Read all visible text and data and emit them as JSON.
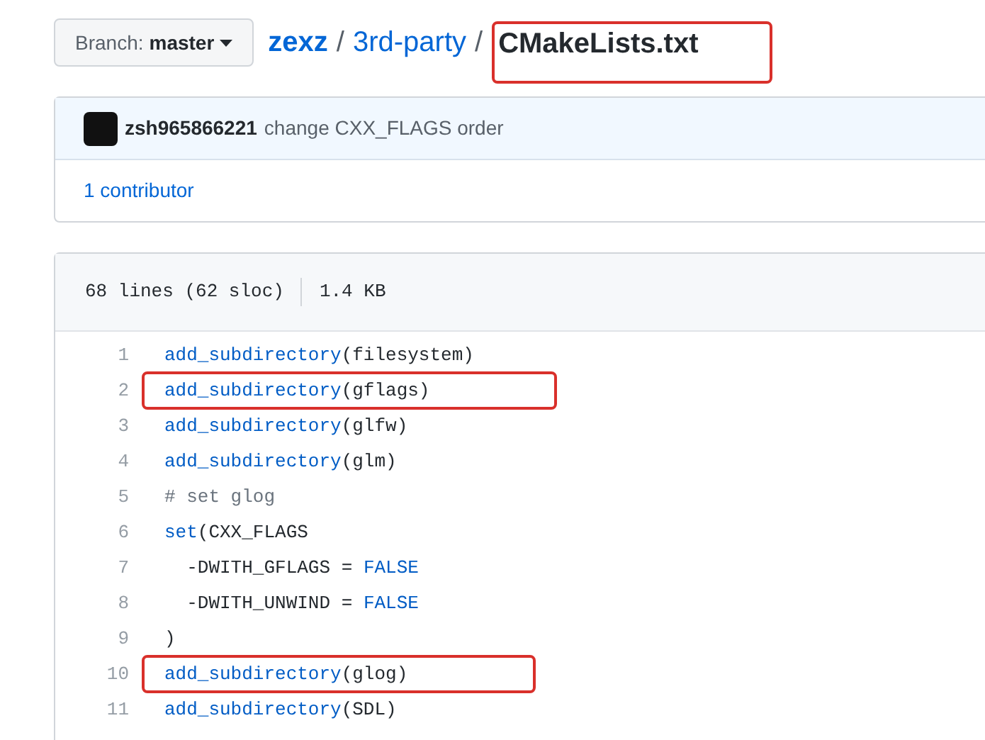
{
  "branch_button": {
    "label": "Branch:",
    "value": "master"
  },
  "breadcrumb": [
    {
      "text": "zexz",
      "kind": "repo",
      "annotated": false
    },
    {
      "text": "/",
      "kind": "separator",
      "annotated": false
    },
    {
      "text": "3rd-party",
      "kind": "folder",
      "annotated": false
    },
    {
      "text": "/",
      "kind": "separator",
      "annotated": false
    },
    {
      "text": "CMakeLists.txt",
      "kind": "file",
      "annotated": true
    }
  ],
  "commit": {
    "author": "zsh965866221",
    "message": "change CXX_FLAGS order",
    "contributors": "1 contributor"
  },
  "file_info": {
    "lines": "68 lines (62 sloc)",
    "size": "1.4 KB"
  },
  "code_lines": [
    {
      "number": "1",
      "annotated": false,
      "tokens": [
        {
          "kind": "fn",
          "text": "add_subdirectory"
        },
        {
          "kind": "plain",
          "text": "(filesystem)"
        }
      ]
    },
    {
      "number": "2",
      "annotated": true,
      "tokens": [
        {
          "kind": "fn",
          "text": "add_subdirectory"
        },
        {
          "kind": "plain",
          "text": "(gflags)"
        }
      ]
    },
    {
      "number": "3",
      "annotated": false,
      "tokens": [
        {
          "kind": "fn",
          "text": "add_subdirectory"
        },
        {
          "kind": "plain",
          "text": "(glfw)"
        }
      ]
    },
    {
      "number": "4",
      "annotated": false,
      "tokens": [
        {
          "kind": "fn",
          "text": "add_subdirectory"
        },
        {
          "kind": "plain",
          "text": "(glm)"
        }
      ]
    },
    {
      "number": "5",
      "annotated": false,
      "tokens": [
        {
          "kind": "comment",
          "text": "# set glog"
        }
      ]
    },
    {
      "number": "6",
      "annotated": false,
      "tokens": [
        {
          "kind": "fn",
          "text": "set"
        },
        {
          "kind": "plain",
          "text": "(CXX_FLAGS"
        }
      ]
    },
    {
      "number": "7",
      "annotated": false,
      "tokens": [
        {
          "kind": "plain",
          "text": "  -DWITH_GFLAGS = "
        },
        {
          "kind": "const",
          "text": "FALSE"
        }
      ]
    },
    {
      "number": "8",
      "annotated": false,
      "tokens": [
        {
          "kind": "plain",
          "text": "  -DWITH_UNWIND = "
        },
        {
          "kind": "const",
          "text": "FALSE"
        }
      ]
    },
    {
      "number": "9",
      "annotated": false,
      "tokens": [
        {
          "kind": "plain",
          "text": ")"
        }
      ]
    },
    {
      "number": "10",
      "annotated": true,
      "tokens": [
        {
          "kind": "fn",
          "text": "add_subdirectory"
        },
        {
          "kind": "plain",
          "text": "(glog)"
        }
      ]
    },
    {
      "number": "11",
      "annotated": false,
      "tokens": [
        {
          "kind": "fn",
          "text": "add_subdirectory"
        },
        {
          "kind": "plain",
          "text": "(SDL)"
        }
      ]
    }
  ]
}
